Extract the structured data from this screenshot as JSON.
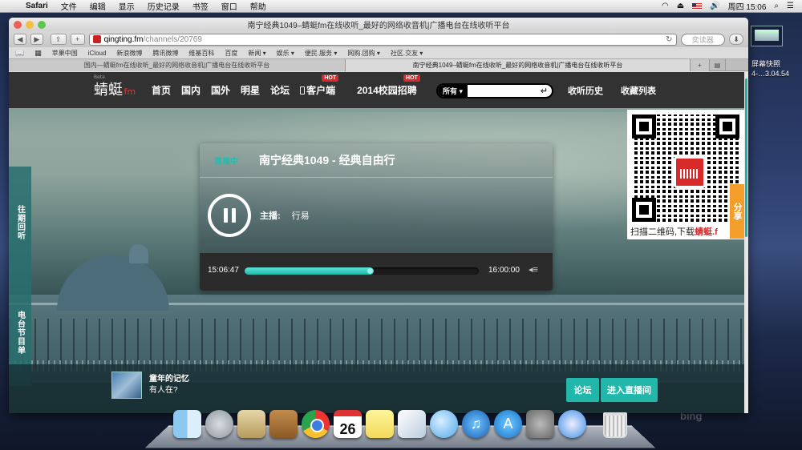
{
  "menubar": {
    "app": "Safari",
    "items": [
      "文件",
      "编辑",
      "显示",
      "历史记录",
      "书签",
      "窗口",
      "帮助"
    ],
    "clock": "周四 15:06"
  },
  "desktop": {
    "thumb_label_1": "屏幕快照",
    "thumb_label_2": "4-…3.04.54",
    "watermark": "bing"
  },
  "browser": {
    "title": "南宁经典1049–蜻蜓fm在线收听_最好的网络收音机|广播电台在线收听平台",
    "address_domain": "qingting.fm",
    "address_path": "/channels/20769",
    "search_placeholder": "奕读器",
    "bookmarks": [
      "苹果中国",
      "iCloud",
      "新浪微博",
      "腾讯微博",
      "维基百科",
      "百度",
      "新闻 ▾",
      "娱乐 ▾",
      "便民.服务 ▾",
      "网购.团购 ▾",
      "社区.交友 ▾"
    ],
    "tabs": [
      "国内—蜻蜓fm在线收听_最好的网络收音机|广播电台在线收听平台",
      "南宁经典1049–蜻蜓fm在线收听_最好的网络收音机|广播电台在线收听平台"
    ]
  },
  "site": {
    "logo_beta": "Beta",
    "logo_text": "蜻蜓",
    "logo_fm": ".fm",
    "nav": [
      "首页",
      "国内",
      "国外",
      "明星",
      "论坛",
      "客户端",
      "2014校园招聘"
    ],
    "hot_badge": "HOT",
    "search_scope": "所有 ▾",
    "search_enter": "↵",
    "nav_right": [
      "收听历史",
      "收藏列表"
    ],
    "side_tabs": [
      "往期回听",
      "电台节目单"
    ],
    "share_label": "分享",
    "qr_caption_prefix": "扫描二维码,下载",
    "qr_caption_brand": "蜻蜓.f"
  },
  "player": {
    "live_label": "直播中",
    "title": "南宁经典1049 - 经典自由行",
    "host_label": "主播:",
    "host_name": "行易",
    "time_start": "15:06:47",
    "time_end": "16:00:00",
    "progress": 0.55,
    "volume_icon": "◂≡"
  },
  "bottom": {
    "memory_title": "童年的记忆",
    "memory_sub": "有人在?",
    "forum_button": "论坛",
    "live_room_button": "进入直播间"
  },
  "dock": {
    "calendar_day": "26"
  }
}
